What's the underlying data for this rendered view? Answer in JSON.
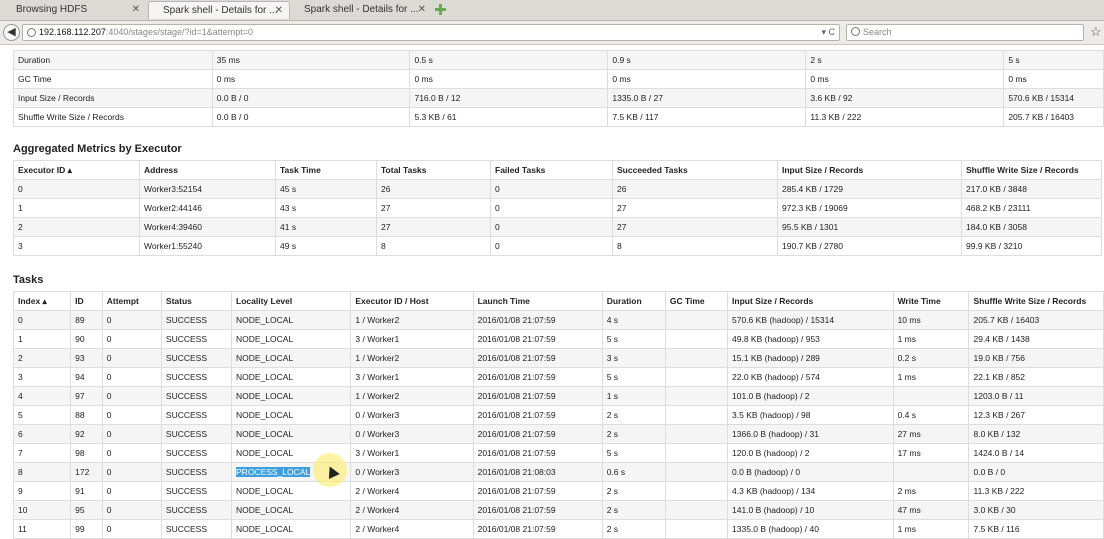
{
  "browser": {
    "tabs": [
      {
        "title": "Browsing HDFS",
        "active": false
      },
      {
        "title": "Spark shell - Details for ...",
        "active": true
      },
      {
        "title": "Spark shell - Details for ...",
        "active": false
      }
    ],
    "url_host": "192.168.112.207",
    "url_path": ":4040/stages/stage/?id=1&attempt=0",
    "search_placeholder": "Search"
  },
  "summary": {
    "rows": [
      {
        "label": "Duration",
        "values": [
          "35 ms",
          "0.5 s",
          "0.9 s",
          "2 s",
          "5 s"
        ]
      },
      {
        "label": "GC Time",
        "values": [
          "0 ms",
          "0 ms",
          "0 ms",
          "0 ms",
          "0 ms"
        ]
      },
      {
        "label": "Input Size / Records",
        "values": [
          "0.0 B / 0",
          "716.0 B / 12",
          "1335.0 B / 27",
          "3.6 KB / 92",
          "570.6 KB / 15314"
        ]
      },
      {
        "label": "Shuffle Write Size / Records",
        "values": [
          "0.0 B / 0",
          "5.3 KB / 61",
          "7.5 KB / 117",
          "11.3 KB / 222",
          "205.7 KB / 16403"
        ]
      }
    ]
  },
  "executors": {
    "heading": "Aggregated Metrics by Executor",
    "columns": [
      "Executor ID ▴",
      "Address",
      "Task Time",
      "Total Tasks",
      "Failed Tasks",
      "Succeeded Tasks",
      "Input Size / Records",
      "Shuffle Write Size / Records"
    ],
    "rows": [
      [
        "0",
        "Worker3:52154",
        "45 s",
        "26",
        "0",
        "26",
        "285.4 KB / 1729",
        "217.0 KB / 3848"
      ],
      [
        "1",
        "Worker2:44146",
        "43 s",
        "27",
        "0",
        "27",
        "972.3 KB / 19069",
        "468.2 KB / 23111"
      ],
      [
        "2",
        "Worker4:39460",
        "41 s",
        "27",
        "0",
        "27",
        "95.5 KB / 1301",
        "184.0 KB / 3058"
      ],
      [
        "3",
        "Worker1:55240",
        "49 s",
        "8",
        "0",
        "8",
        "190.7 KB / 2780",
        "99.9 KB / 3210"
      ]
    ]
  },
  "tasks": {
    "heading": "Tasks",
    "columns": [
      "Index ▴",
      "ID",
      "Attempt",
      "Status",
      "Locality Level",
      "Executor ID / Host",
      "Launch Time",
      "Duration",
      "GC Time",
      "Input Size / Records",
      "Write Time",
      "Shuffle Write Size / Records"
    ],
    "rows": [
      [
        "0",
        "89",
        "0",
        "SUCCESS",
        "NODE_LOCAL",
        "1 / Worker2",
        "2016/01/08 21:07:59",
        "4 s",
        "",
        "570.6 KB (hadoop) / 15314",
        "10 ms",
        "205.7 KB / 16403"
      ],
      [
        "1",
        "90",
        "0",
        "SUCCESS",
        "NODE_LOCAL",
        "3 / Worker1",
        "2016/01/08 21:07:59",
        "5 s",
        "",
        "49.8 KB (hadoop) / 953",
        "1 ms",
        "29.4 KB / 1438"
      ],
      [
        "2",
        "93",
        "0",
        "SUCCESS",
        "NODE_LOCAL",
        "1 / Worker2",
        "2016/01/08 21:07:59",
        "3 s",
        "",
        "15.1 KB (hadoop) / 289",
        "0.2 s",
        "19.0 KB / 756"
      ],
      [
        "3",
        "94",
        "0",
        "SUCCESS",
        "NODE_LOCAL",
        "3 / Worker1",
        "2016/01/08 21:07:59",
        "5 s",
        "",
        "22.0 KB (hadoop) / 574",
        "1 ms",
        "22.1 KB / 852"
      ],
      [
        "4",
        "97",
        "0",
        "SUCCESS",
        "NODE_LOCAL",
        "1 / Worker2",
        "2016/01/08 21:07:59",
        "1 s",
        "",
        "101.0 B (hadoop) / 2",
        "",
        "1203.0 B / 11"
      ],
      [
        "5",
        "88",
        "0",
        "SUCCESS",
        "NODE_LOCAL",
        "0 / Worker3",
        "2016/01/08 21:07:59",
        "2 s",
        "",
        "3.5 KB (hadoop) / 98",
        "0.4 s",
        "12.3 KB / 267"
      ],
      [
        "6",
        "92",
        "0",
        "SUCCESS",
        "NODE_LOCAL",
        "0 / Worker3",
        "2016/01/08 21:07:59",
        "2 s",
        "",
        "1366.0 B (hadoop) / 31",
        "27 ms",
        "8.0 KB / 132"
      ],
      [
        "7",
        "98",
        "0",
        "SUCCESS",
        "NODE_LOCAL",
        "3 / Worker1",
        "2016/01/08 21:07:59",
        "5 s",
        "",
        "120.0 B (hadoop) / 2",
        "17 ms",
        "1424.0 B / 14"
      ],
      [
        "8",
        "172",
        "0",
        "SUCCESS",
        "PROCESS_LOCAL",
        "0 / Worker3",
        "2016/01/08 21:08:03",
        "0.6 s",
        "",
        "0.0 B (hadoop) / 0",
        "",
        "0.0 B / 0"
      ],
      [
        "9",
        "91",
        "0",
        "SUCCESS",
        "NODE_LOCAL",
        "2 / Worker4",
        "2016/01/08 21:07:59",
        "2 s",
        "",
        "4.3 KB (hadoop) / 134",
        "2 ms",
        "11.3 KB / 222"
      ],
      [
        "10",
        "95",
        "0",
        "SUCCESS",
        "NODE_LOCAL",
        "2 / Worker4",
        "2016/01/08 21:07:59",
        "2 s",
        "",
        "141.0 B (hadoop) / 10",
        "47 ms",
        "3.0 KB / 30"
      ],
      [
        "11",
        "99",
        "0",
        "SUCCESS",
        "NODE_LOCAL",
        "2 / Worker4",
        "2016/01/08 21:07:59",
        "2 s",
        "",
        "1335.0 B (hadoop) / 40",
        "1 ms",
        "7.5 KB / 116"
      ]
    ],
    "highlight": {
      "row": 8,
      "col": 4,
      "color": "#3d9fe0"
    }
  }
}
